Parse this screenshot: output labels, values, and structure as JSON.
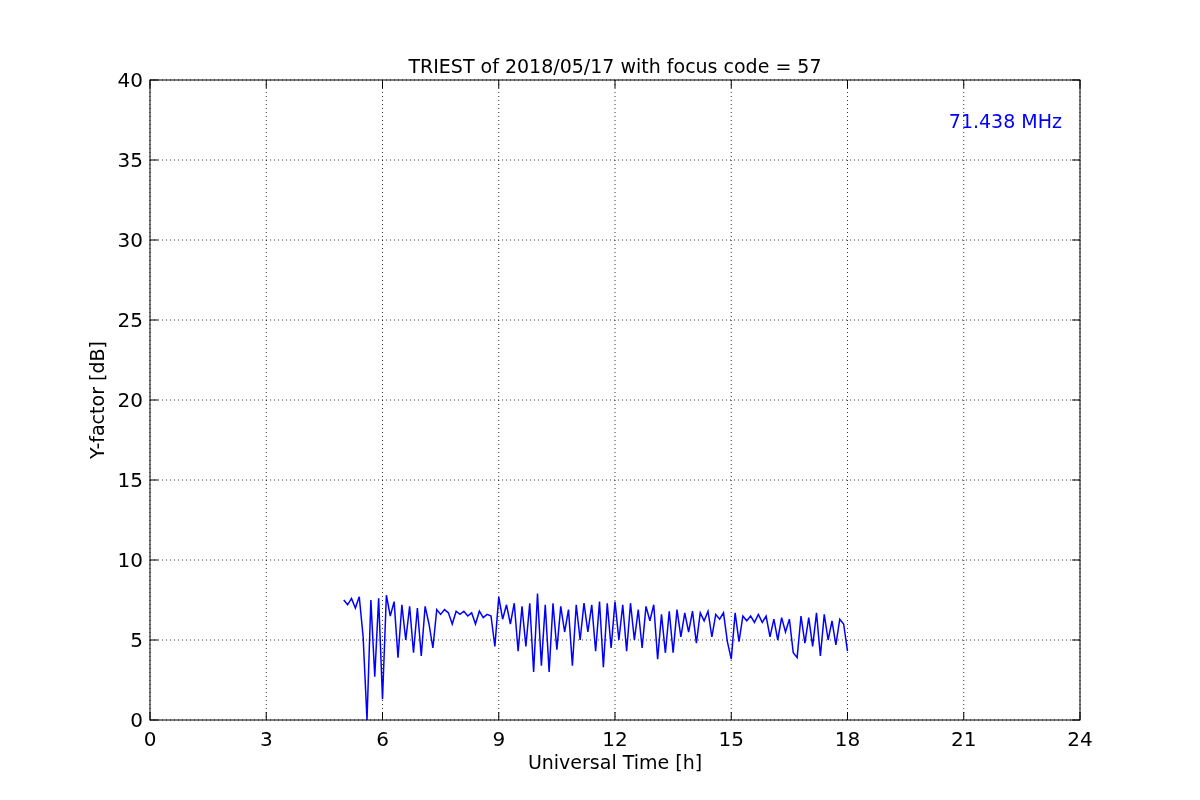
{
  "chart_data": {
    "type": "line",
    "title": "TRIEST of 2018/05/17 with focus code = 57",
    "xlabel": "Universal Time [h]",
    "ylabel": "Y-factor [dB]",
    "xlim": [
      0,
      24
    ],
    "ylim": [
      0,
      40
    ],
    "xticks": [
      0,
      3,
      6,
      9,
      12,
      15,
      18,
      21,
      24
    ],
    "yticks": [
      0,
      5,
      10,
      15,
      20,
      25,
      30,
      35,
      40
    ],
    "grid": true,
    "annotations": [
      {
        "text": "71.438 MHz"
      }
    ],
    "x": [
      5.0,
      5.1,
      5.2,
      5.3,
      5.4,
      5.5,
      5.6,
      5.7,
      5.8,
      5.9,
      6.0,
      6.1,
      6.2,
      6.3,
      6.4,
      6.5,
      6.6,
      6.7,
      6.8,
      6.9,
      7.0,
      7.1,
      7.2,
      7.3,
      7.4,
      7.5,
      7.6,
      7.7,
      7.8,
      7.9,
      8.0,
      8.1,
      8.2,
      8.3,
      8.4,
      8.5,
      8.6,
      8.7,
      8.8,
      8.9,
      9.0,
      9.1,
      9.2,
      9.3,
      9.4,
      9.5,
      9.6,
      9.7,
      9.8,
      9.9,
      10.0,
      10.1,
      10.2,
      10.3,
      10.4,
      10.5,
      10.6,
      10.7,
      10.8,
      10.9,
      11.0,
      11.1,
      11.2,
      11.3,
      11.4,
      11.5,
      11.6,
      11.7,
      11.8,
      11.9,
      12.0,
      12.1,
      12.2,
      12.3,
      12.4,
      12.5,
      12.6,
      12.7,
      12.8,
      12.9,
      13.0,
      13.1,
      13.2,
      13.3,
      13.4,
      13.5,
      13.6,
      13.7,
      13.8,
      13.9,
      14.0,
      14.1,
      14.2,
      14.3,
      14.4,
      14.5,
      14.6,
      14.7,
      14.8,
      14.9,
      15.0,
      15.1,
      15.2,
      15.3,
      15.4,
      15.5,
      15.6,
      15.7,
      15.8,
      15.9,
      16.0,
      16.1,
      16.2,
      16.3,
      16.4,
      16.5,
      16.6,
      16.7,
      16.8,
      16.9,
      17.0,
      17.1,
      17.2,
      17.3,
      17.4,
      17.5,
      17.6,
      17.7,
      17.8,
      17.9,
      18.0
    ],
    "series": [
      {
        "color": "#0000ff",
        "values": [
          7.5,
          7.2,
          7.6,
          7.0,
          7.7,
          5.2,
          0.0,
          7.5,
          2.7,
          7.6,
          1.3,
          7.8,
          6.5,
          7.4,
          3.9,
          7.2,
          5.0,
          7.1,
          4.2,
          7.0,
          4.0,
          7.1,
          6.0,
          4.5,
          6.9,
          6.6,
          6.9,
          6.7,
          6.0,
          6.8,
          6.6,
          6.8,
          6.5,
          6.7,
          6.0,
          6.8,
          6.4,
          6.6,
          6.5,
          4.6,
          7.7,
          6.3,
          7.2,
          6.0,
          7.3,
          4.3,
          7.1,
          4.6,
          7.3,
          3.0,
          7.9,
          3.4,
          7.2,
          3.0,
          7.3,
          4.4,
          7.1,
          5.5,
          6.9,
          3.4,
          7.2,
          5.0,
          7.3,
          5.5,
          7.2,
          4.3,
          7.4,
          3.3,
          7.3,
          4.5,
          7.4,
          5.0,
          7.2,
          4.3,
          7.3,
          5.0,
          6.9,
          4.5,
          7.1,
          6.2,
          7.2,
          3.8,
          6.6,
          4.2,
          6.8,
          4.2,
          6.9,
          5.2,
          6.7,
          5.5,
          6.8,
          4.8,
          6.7,
          6.2,
          6.8,
          5.2,
          6.6,
          6.3,
          6.7,
          4.9,
          3.8,
          6.7,
          4.9,
          6.5,
          6.2,
          6.5,
          6.1,
          6.6,
          6.1,
          6.5,
          5.2,
          6.3,
          5.0,
          6.4,
          5.5,
          6.3,
          4.2,
          3.9,
          6.5,
          4.8,
          6.4,
          4.6,
          6.7,
          4.0,
          6.6,
          5.0,
          6.2,
          4.7,
          6.3,
          6.0,
          4.3
        ]
      }
    ]
  }
}
